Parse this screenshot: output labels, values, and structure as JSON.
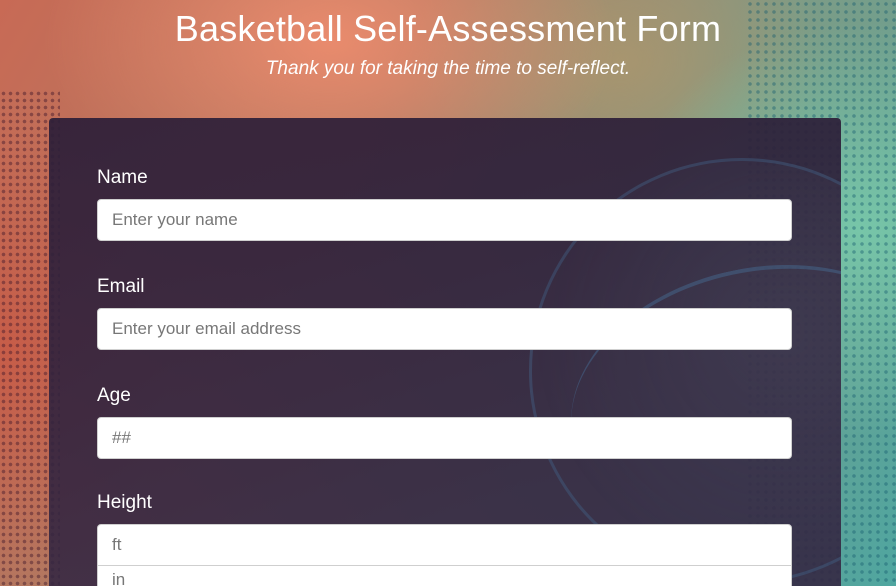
{
  "header": {
    "title": "Basketball Self-Assessment Form",
    "subtitle": "Thank you for taking the time to self-reflect."
  },
  "form": {
    "name": {
      "label": "Name",
      "placeholder": "Enter your name",
      "value": ""
    },
    "email": {
      "label": "Email",
      "placeholder": "Enter your email address",
      "value": ""
    },
    "age": {
      "label": "Age",
      "placeholder": "##",
      "value": ""
    },
    "height": {
      "label": "Height",
      "feet_placeholder": "ft",
      "inches_placeholder": "in",
      "value": ""
    }
  },
  "colors": {
    "panel_background": "#2c1e38",
    "title_text": "#ffffff",
    "input_background": "#ffffff"
  }
}
